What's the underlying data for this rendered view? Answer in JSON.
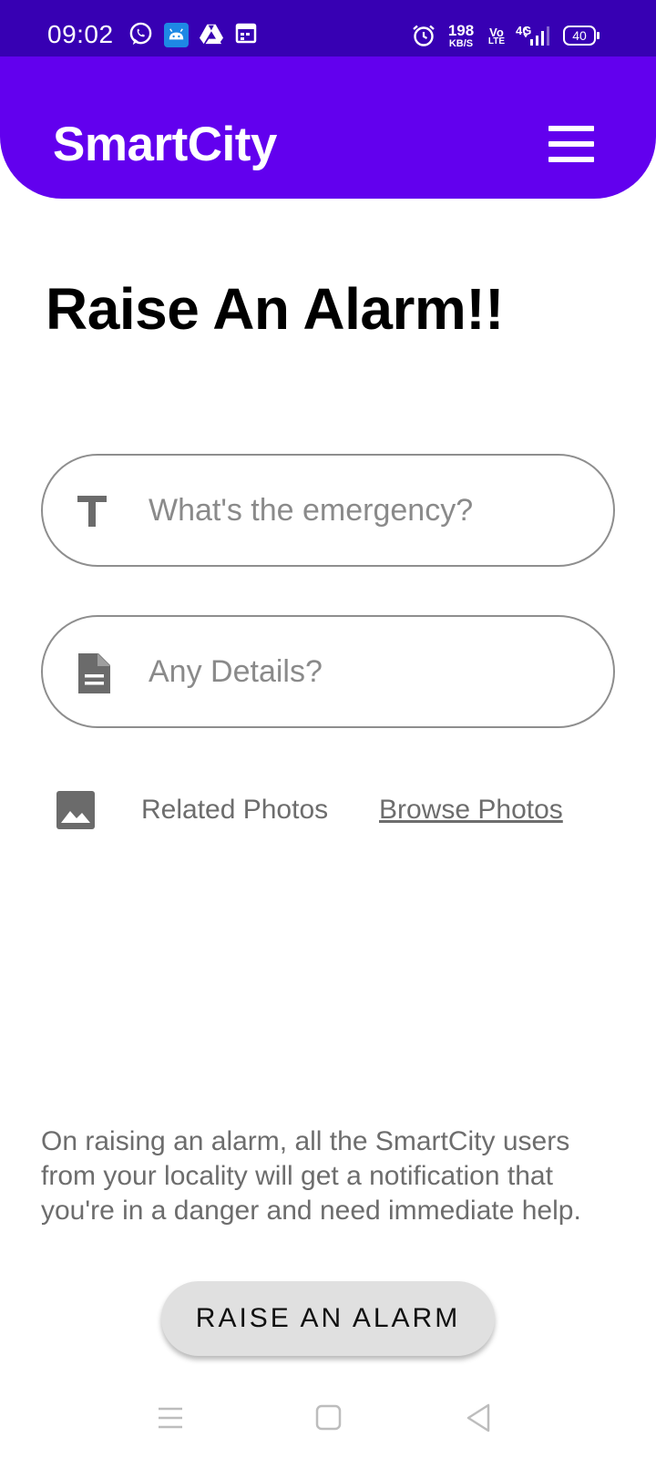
{
  "status_bar": {
    "time": "09:02",
    "net_speed_value": "198",
    "net_speed_unit": "KB/S",
    "volte_top": "Vo",
    "volte_bottom": "LTE",
    "network_type": "4G",
    "battery_level": "40"
  },
  "app_bar": {
    "title": "SmartCity",
    "color": "#6200ee"
  },
  "page": {
    "heading": "Raise An Alarm!!"
  },
  "form": {
    "emergency_placeholder": "What's the emergency?",
    "emergency_value": "",
    "details_placeholder": "Any Details?",
    "details_value": "",
    "photos_label": "Related Photos",
    "browse_label": "Browse Photos"
  },
  "info": {
    "text": "On raising an alarm, all the SmartCity users from your locality will get a notification that you're in a danger and need immediate help."
  },
  "actions": {
    "raise_label": "RAISE AN ALARM"
  },
  "icons": {
    "status_left": [
      "whatsapp-icon",
      "android-app-icon",
      "drive-icon",
      "calendar-icon"
    ],
    "status_right": [
      "alarm-clock-icon",
      "signal-icon",
      "battery-icon"
    ],
    "menu": "hamburger-menu-icon",
    "emergency_field": "text-format-icon",
    "details_field": "document-icon",
    "photos": "image-icon",
    "nav": [
      "recents-icon",
      "home-icon",
      "back-icon"
    ]
  },
  "colors": {
    "status_bar": "#3700b3",
    "primary": "#6200ee",
    "button_bg": "#e0e0e0",
    "secondary_text": "#6d6d6d"
  }
}
